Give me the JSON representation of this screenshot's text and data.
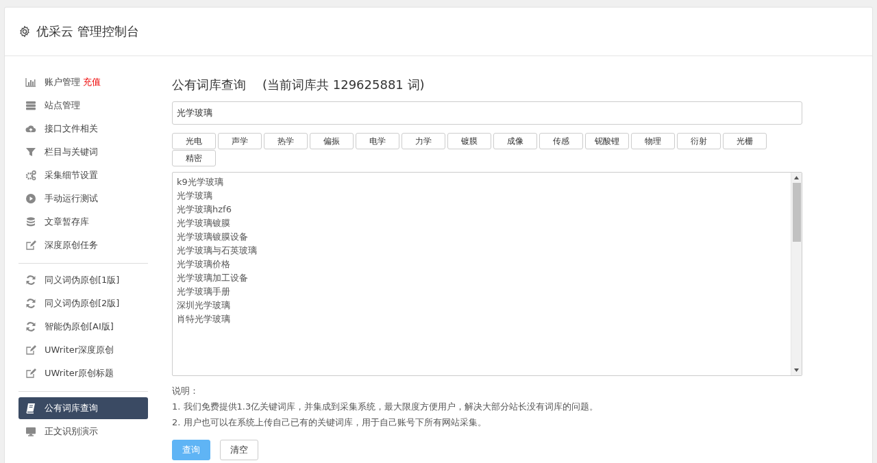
{
  "header": {
    "title": "优采云 管理控制台"
  },
  "sidebar": {
    "groups": [
      [
        {
          "label": "账户管理",
          "badge": "充值",
          "selected": false
        },
        {
          "label": "站点管理",
          "selected": false
        },
        {
          "label": "接口文件相关",
          "selected": false
        },
        {
          "label": "栏目与关键词",
          "selected": false
        },
        {
          "label": "采集细节设置",
          "selected": false
        },
        {
          "label": "手动运行测试",
          "selected": false
        },
        {
          "label": "文章暂存库",
          "selected": false
        },
        {
          "label": "深度原创任务",
          "selected": false
        }
      ],
      [
        {
          "label": "同义词伪原创[1版]",
          "selected": false
        },
        {
          "label": "同义词伪原创[2版]",
          "selected": false
        },
        {
          "label": "智能伪原创[AI版]",
          "selected": false
        },
        {
          "label": "UWriter深度原创",
          "selected": false
        },
        {
          "label": "UWriter原创标题",
          "selected": false
        }
      ],
      [
        {
          "label": "公有词库查询",
          "selected": true
        },
        {
          "label": "正文识别演示",
          "selected": false
        }
      ]
    ]
  },
  "main": {
    "title": "公有词库查询",
    "count": "(当前词库共 129625881 词)",
    "search": {
      "value": "光学玻璃"
    },
    "tags": [
      "光电",
      "声学",
      "热学",
      "偏振",
      "电学",
      "力学",
      "镀膜",
      "成像",
      "传感",
      "铌酸锂",
      "物理",
      "衍射",
      "光栅",
      "精密"
    ],
    "results": [
      "k9光学玻璃",
      "光学玻璃",
      "光学玻璃hzf6",
      "光学玻璃镀膜",
      "光学玻璃镀膜设备",
      "光学玻璃与石英玻璃",
      "光学玻璃价格",
      "光学玻璃加工设备",
      "光学玻璃手册",
      "深圳光学玻璃",
      "肖特光学玻璃"
    ],
    "notes_title": "说明：",
    "notes": [
      "1. 我们免费提供1.3亿关键词库，并集成到采集系统，最大限度方便用户，解决大部分站长没有词库的问题。",
      "2. 用户也可以在系统上传自己已有的关键词库，用于自己账号下所有网站采集。"
    ],
    "buttons": [
      {
        "label": "查询",
        "kind": "primary"
      },
      {
        "label": "清空",
        "kind": "default"
      }
    ]
  }
}
